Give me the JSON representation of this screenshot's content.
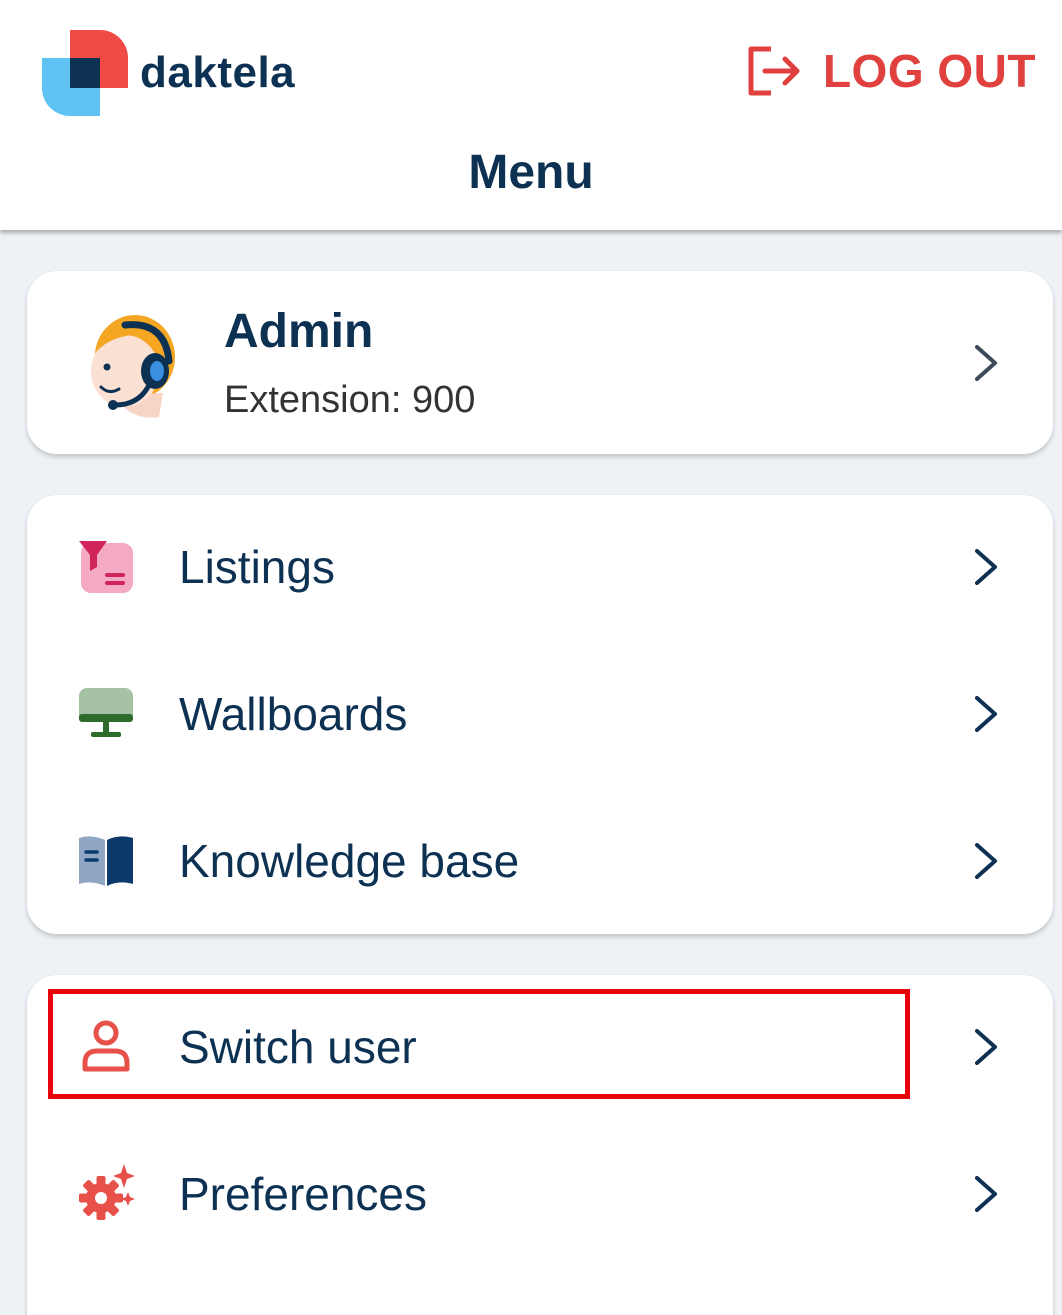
{
  "header": {
    "brand_name": "daktela",
    "logout_label": "LOG OUT",
    "page_title": "Menu"
  },
  "profile": {
    "name": "Admin",
    "extension": "Extension: 900"
  },
  "menu_group_1": {
    "items": [
      {
        "label": "Listings",
        "icon": "listings-icon"
      },
      {
        "label": "Wallboards",
        "icon": "wallboard-monitor-icon"
      },
      {
        "label": "Knowledge base",
        "icon": "book-icon"
      }
    ]
  },
  "menu_group_2": {
    "items": [
      {
        "label": "Switch user",
        "icon": "user-icon"
      },
      {
        "label": "Preferences",
        "icon": "gear-sparkle-icon"
      }
    ]
  },
  "colors": {
    "brand_navy": "#0d3152",
    "logout_red": "#e0403e",
    "highlight_red": "#e8000a",
    "background": "#eef2f6"
  }
}
